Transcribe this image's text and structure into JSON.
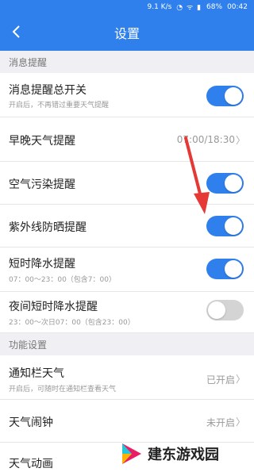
{
  "status_bar": {
    "speed": "9.1 K/s",
    "battery": "68%",
    "time": "00:42"
  },
  "header": {
    "title": "设置"
  },
  "sections": [
    {
      "title": "消息提醒"
    },
    {
      "title": "功能设置"
    }
  ],
  "rows": [
    {
      "title": "消息提醒总开关",
      "subtitle": "开启后，不再错过重要天气提醒",
      "toggle": "on"
    },
    {
      "title": "早晚天气提醒",
      "value": "07:00/18:30"
    },
    {
      "title": "空气污染提醒",
      "toggle": "on"
    },
    {
      "title": "紫外线防晒提醒",
      "toggle": "on"
    },
    {
      "title": "短时降水提醒",
      "subtitle": "07：00～23：00（包含7：00）",
      "toggle": "on"
    },
    {
      "title": "夜间短时降水提醒",
      "subtitle": "23：00～次日07：00（包含23：00）",
      "toggle": "off"
    },
    {
      "title": "通知栏天气",
      "subtitle": "开启后，可随时在通知栏查看天气",
      "value": "已开启"
    },
    {
      "title": "天气闹钟",
      "value": "未开启"
    },
    {
      "title": "天气动画"
    }
  ],
  "watermark": {
    "text": "建东游戏园"
  },
  "colors": {
    "accent": "#2f80ed",
    "arrow": "#e53935"
  }
}
